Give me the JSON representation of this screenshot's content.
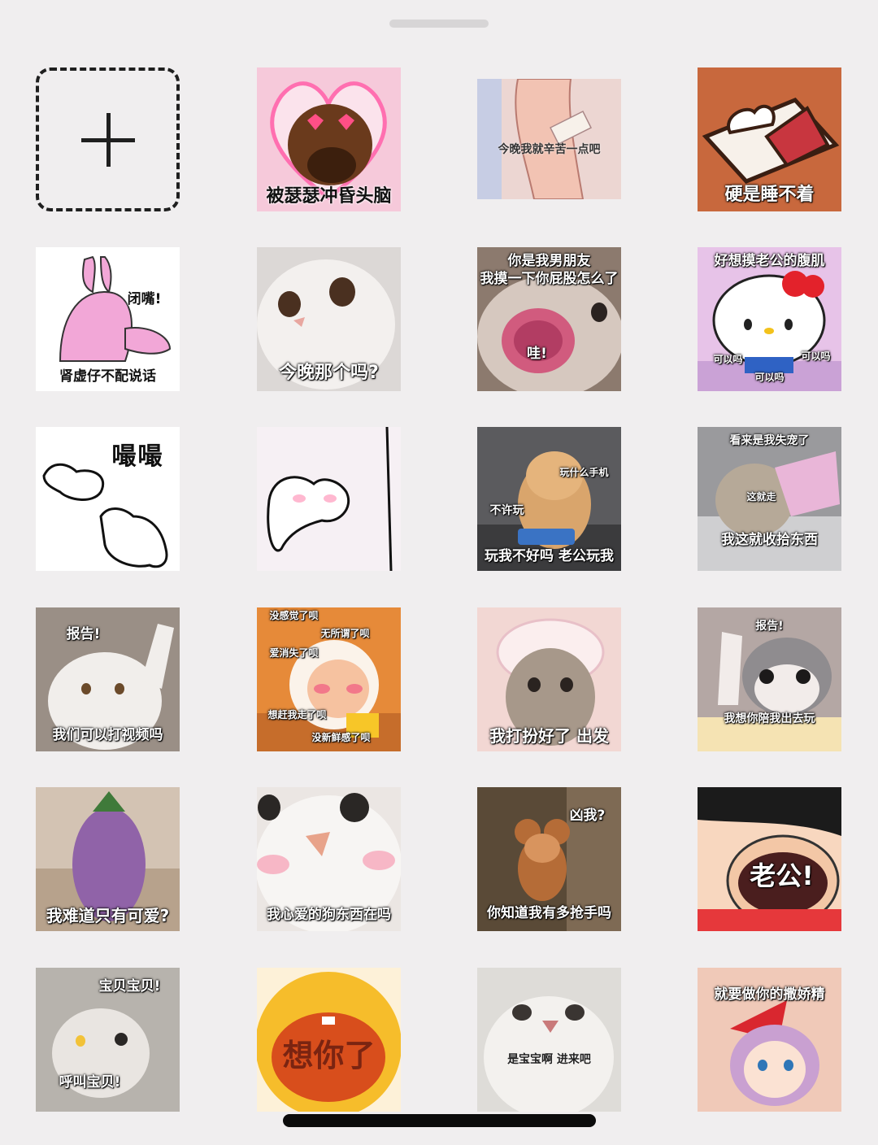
{
  "header": {
    "handle": "drag-handle"
  },
  "add_button": {
    "icon": "plus-icon"
  },
  "stickers": [
    {
      "id": "s1",
      "caption": "被瑟瑟冲昏头脑"
    },
    {
      "id": "s2",
      "caption": "今晚我就辛苦一点吧"
    },
    {
      "id": "s3",
      "caption": "硬是睡不着"
    },
    {
      "id": "s4",
      "caption_top": "闭嘴!",
      "caption": "肾虚仔不配说话"
    },
    {
      "id": "s5",
      "caption": "今晚那个吗?"
    },
    {
      "id": "s6",
      "caption_top": "你是我男朋友",
      "caption_top2": "我摸一下你屁股怎么了",
      "caption": "哇!"
    },
    {
      "id": "s7",
      "caption_top": "好想摸老公的腹肌",
      "caption_left": "可以吗",
      "caption_right": "可以吗",
      "caption": "可以吗"
    },
    {
      "id": "s8",
      "caption_top": "嘬嘬"
    },
    {
      "id": "s9",
      "caption": ""
    },
    {
      "id": "s10",
      "caption_top": "玩什么手机",
      "caption_mid": "不许玩",
      "caption": "玩我不好吗 老公玩我"
    },
    {
      "id": "s11",
      "caption_top": "看来是我失宠了",
      "caption_mid": "这就走",
      "caption": "我这就收拾东西"
    },
    {
      "id": "s12",
      "caption_top": "报告!",
      "caption": "我们可以打视频吗"
    },
    {
      "id": "s13",
      "lines": [
        "没感觉了呗",
        "无所谓了呗",
        "爱消失了呗",
        "想赶我走了呗",
        "没新鲜感了呗"
      ]
    },
    {
      "id": "s14",
      "caption": "我打扮好了 出发"
    },
    {
      "id": "s15",
      "caption_top": "报告!",
      "caption": "我想你陪我出去玩"
    },
    {
      "id": "s16",
      "caption": "我难道只有可爱?"
    },
    {
      "id": "s17",
      "caption": "我心爱的狗东西在吗"
    },
    {
      "id": "s18",
      "caption_top": "凶我?",
      "caption": "你知道我有多抢手吗"
    },
    {
      "id": "s19",
      "caption": "老公!"
    },
    {
      "id": "s20",
      "caption_top": "宝贝宝贝!",
      "caption": "呼叫宝贝!"
    },
    {
      "id": "s21",
      "caption": "想你了"
    },
    {
      "id": "s22",
      "caption": "是宝宝啊 进来吧"
    },
    {
      "id": "s23",
      "caption_top": "就要做你的撒娇精"
    }
  ],
  "colors": {
    "background": "#f0eeef",
    "handle": "#d7d5d6",
    "home_indicator": "#0b0b0b"
  }
}
